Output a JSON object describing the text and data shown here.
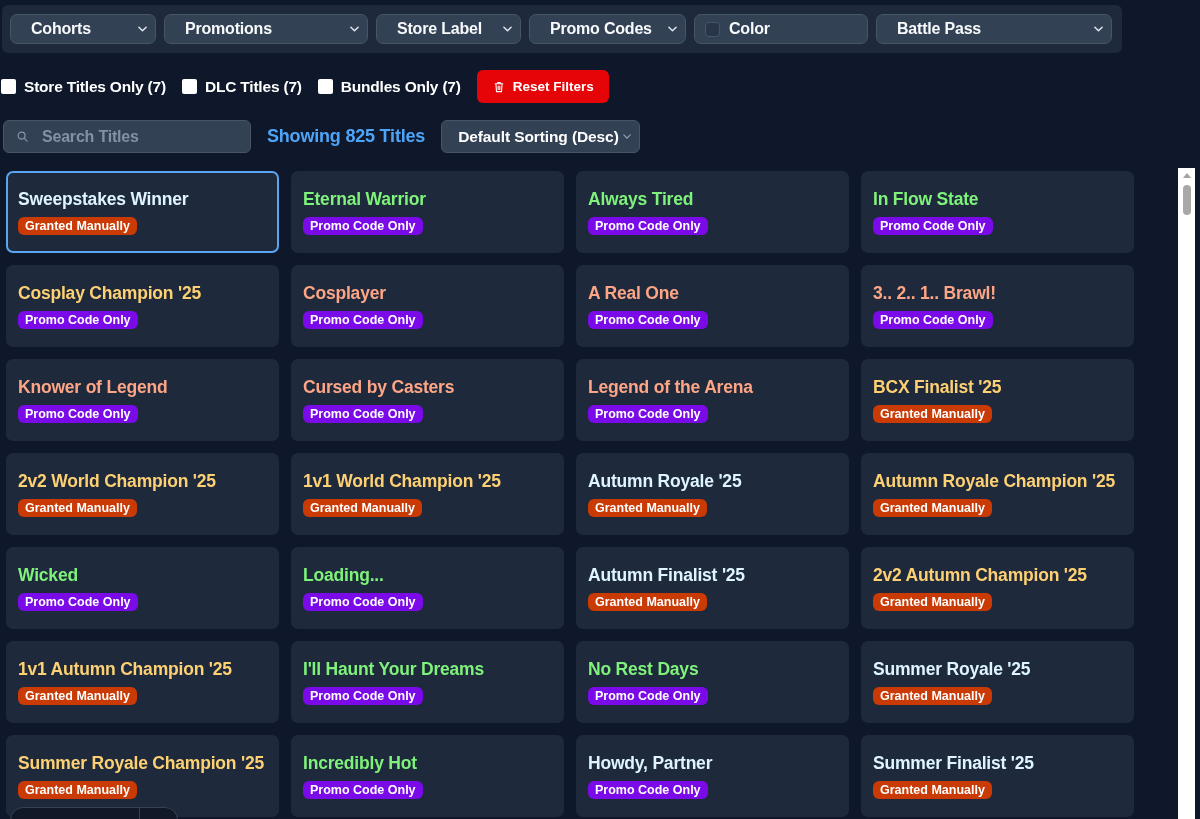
{
  "filters": [
    {
      "kind": "select",
      "label": "Cohorts"
    },
    {
      "kind": "select",
      "label": "Promotions"
    },
    {
      "kind": "select",
      "label": "Store Label"
    },
    {
      "kind": "select",
      "label": "Promo Codes"
    },
    {
      "kind": "color",
      "label": "Color"
    },
    {
      "kind": "select",
      "label": "Battle Pass"
    }
  ],
  "toggles": [
    {
      "label": "Store Titles Only (7)",
      "checked": false
    },
    {
      "label": "DLC Titles (7)",
      "checked": false
    },
    {
      "label": "Bundles Only (7)",
      "checked": false
    }
  ],
  "reset_button": {
    "label": "Reset Filters"
  },
  "search": {
    "placeholder": "Search Titles"
  },
  "result_count": "Showing 825 Titles",
  "sort": {
    "value": "Default Sorting (Desc)"
  },
  "cards": [
    {
      "title": "Sweepstakes Winner",
      "color": "#def5ff",
      "selected": true,
      "badge": {
        "kind": "manual",
        "label": "Granted Manually"
      }
    },
    {
      "title": "Eternal Warrior",
      "color": "#7ef27a",
      "selected": false,
      "badge": {
        "kind": "promo",
        "label": "Promo Code Only"
      }
    },
    {
      "title": "Always Tired",
      "color": "#7ef27a",
      "selected": false,
      "badge": {
        "kind": "promo",
        "label": "Promo Code Only"
      }
    },
    {
      "title": "In Flow State",
      "color": "#7ef27a",
      "selected": false,
      "badge": {
        "kind": "promo",
        "label": "Promo Code Only"
      }
    },
    {
      "title": "Cosplay Champion '25",
      "color": "#fdd173",
      "selected": false,
      "badge": {
        "kind": "promo",
        "label": "Promo Code Only"
      }
    },
    {
      "title": "Cosplayer",
      "color": "#fda585",
      "selected": false,
      "badge": {
        "kind": "promo",
        "label": "Promo Code Only"
      }
    },
    {
      "title": "A Real One",
      "color": "#fda585",
      "selected": false,
      "badge": {
        "kind": "promo",
        "label": "Promo Code Only"
      }
    },
    {
      "title": "3.. 2.. 1.. Brawl!",
      "color": "#fda585",
      "selected": false,
      "badge": {
        "kind": "promo",
        "label": "Promo Code Only"
      }
    },
    {
      "title": "Knower of Legend",
      "color": "#fda585",
      "selected": false,
      "badge": {
        "kind": "promo",
        "label": "Promo Code Only"
      }
    },
    {
      "title": "Cursed by Casters",
      "color": "#fda585",
      "selected": false,
      "badge": {
        "kind": "promo",
        "label": "Promo Code Only"
      }
    },
    {
      "title": "Legend of the Arena",
      "color": "#fda585",
      "selected": false,
      "badge": {
        "kind": "promo",
        "label": "Promo Code Only"
      }
    },
    {
      "title": "BCX Finalist '25",
      "color": "#fdd173",
      "selected": false,
      "badge": {
        "kind": "manual",
        "label": "Granted Manually"
      }
    },
    {
      "title": "2v2 World Champion '25",
      "color": "#fdd173",
      "selected": false,
      "badge": {
        "kind": "manual",
        "label": "Granted Manually"
      }
    },
    {
      "title": "1v1 World Champion '25",
      "color": "#fdd173",
      "selected": false,
      "badge": {
        "kind": "manual",
        "label": "Granted Manually"
      }
    },
    {
      "title": "Autumn Royale '25",
      "color": "#def5ff",
      "selected": false,
      "badge": {
        "kind": "manual",
        "label": "Granted Manually"
      }
    },
    {
      "title": "Autumn Royale Champion '25",
      "color": "#fdd173",
      "selected": false,
      "badge": {
        "kind": "manual",
        "label": "Granted Manually"
      }
    },
    {
      "title": "Wicked",
      "color": "#7ef27a",
      "selected": false,
      "badge": {
        "kind": "promo",
        "label": "Promo Code Only"
      }
    },
    {
      "title": "Loading...",
      "color": "#7ef27a",
      "selected": false,
      "badge": {
        "kind": "promo",
        "label": "Promo Code Only"
      }
    },
    {
      "title": "Autumn Finalist '25",
      "color": "#def5ff",
      "selected": false,
      "badge": {
        "kind": "manual",
        "label": "Granted Manually"
      }
    },
    {
      "title": "2v2 Autumn Champion '25",
      "color": "#fdd173",
      "selected": false,
      "badge": {
        "kind": "manual",
        "label": "Granted Manually"
      }
    },
    {
      "title": "1v1 Autumn Champion '25",
      "color": "#fdd173",
      "selected": false,
      "badge": {
        "kind": "manual",
        "label": "Granted Manually"
      }
    },
    {
      "title": "I'll Haunt Your Dreams",
      "color": "#7ef27a",
      "selected": false,
      "badge": {
        "kind": "promo",
        "label": "Promo Code Only"
      }
    },
    {
      "title": "No Rest Days",
      "color": "#7ef27a",
      "selected": false,
      "badge": {
        "kind": "promo",
        "label": "Promo Code Only"
      }
    },
    {
      "title": "Summer Royale '25",
      "color": "#def5ff",
      "selected": false,
      "badge": {
        "kind": "manual",
        "label": "Granted Manually"
      }
    },
    {
      "title": "Summer Royale Champion '25",
      "color": "#fdd173",
      "selected": false,
      "badge": {
        "kind": "manual",
        "label": "Granted Manually"
      }
    },
    {
      "title": "Incredibly Hot",
      "color": "#7ef27a",
      "selected": false,
      "badge": {
        "kind": "promo",
        "label": "Promo Code Only"
      }
    },
    {
      "title": "Howdy, Partner",
      "color": "#def5ff",
      "selected": false,
      "badge": {
        "kind": "promo",
        "label": "Promo Code Only"
      }
    },
    {
      "title": "Summer Finalist '25",
      "color": "#def5ff",
      "selected": false,
      "badge": {
        "kind": "manual",
        "label": "Granted Manually"
      }
    }
  ]
}
